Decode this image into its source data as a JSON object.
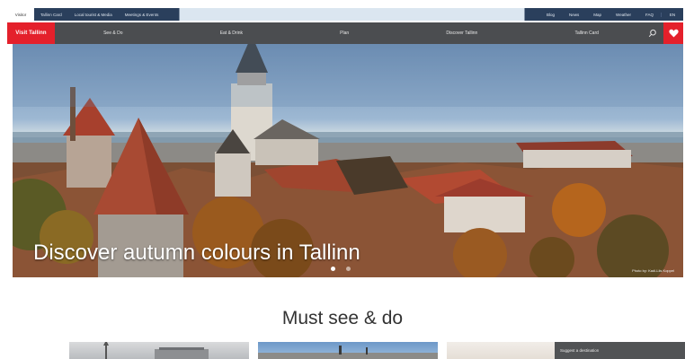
{
  "topbar": {
    "tabs": [
      "Visitor",
      "Tallinn Card",
      "Local tourist & Media",
      "Meetings & Events"
    ],
    "right_links": [
      "Blog",
      "News",
      "Map",
      "Weather",
      "FAQ"
    ],
    "language": "EN"
  },
  "brand": {
    "logo_text": "Visit Tallinn",
    "accent_color": "#e4202b",
    "nav_color": "#4b4d50"
  },
  "mainnav": {
    "items": [
      "See & Do",
      "Eat & Drink",
      "Plan",
      "Discover Tallinn",
      "Tallinn Card"
    ],
    "search_icon": "search-icon",
    "favorites_icon": "heart-icon"
  },
  "hero": {
    "caption": "Discover autumn colours in Tallinn",
    "slides_total": 2,
    "active_slide": 1,
    "credit": "Photo by: Kadi-Liis Koppel"
  },
  "section": {
    "title": "Must see & do",
    "card4_label": "Suggest a destination"
  }
}
